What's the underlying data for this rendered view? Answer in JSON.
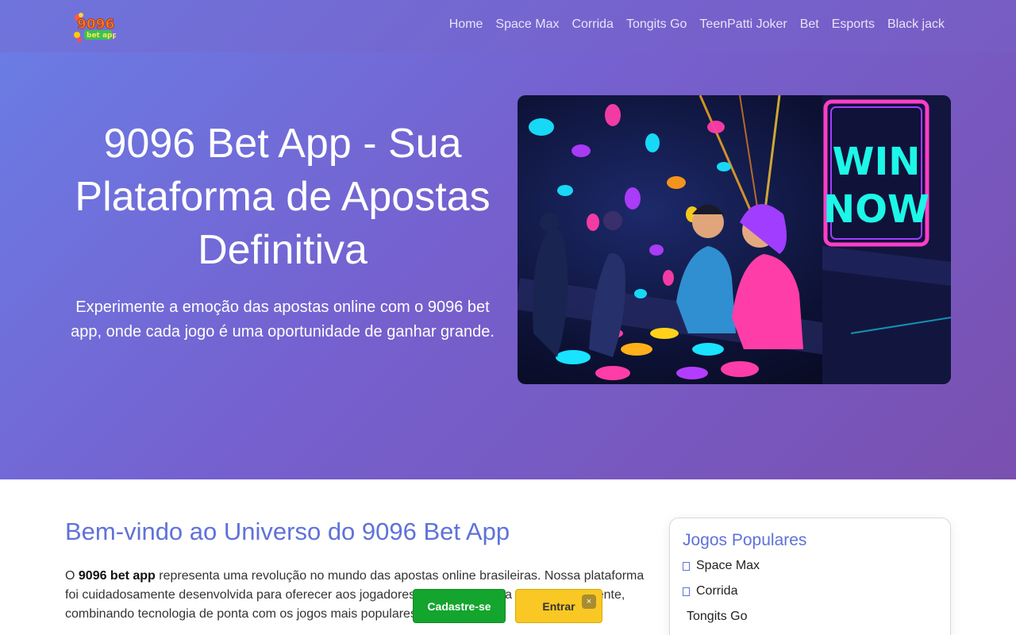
{
  "header": {
    "logo_text": "9096 bet app",
    "nav": [
      "Home",
      "Space Max",
      "Corrida",
      "Tongits Go",
      "TeenPatti Joker",
      "Bet",
      "Esports",
      "Black jack"
    ]
  },
  "hero": {
    "title": "9096 Bet App - Sua Plataforma de Apostas Definitiva",
    "subtitle": "Experimente a emoção das apostas online com o 9096 bet app, onde cada jogo é uma oportunidade de ganhar grande.",
    "image_sign": [
      "WIN",
      "NOW"
    ]
  },
  "main": {
    "heading": "Bem-vindo ao Universo do 9096 Bet App",
    "intro_prefix": "O ",
    "intro_bold": "9096 bet app",
    "intro_rest": " representa uma revolução no mundo das apostas online brasileiras. Nossa plataforma foi cuidadosamente desenvolvida para oferecer aos jogadores uma experiência única e envolvente, combinando tecnologia de ponta com os jogos mais populares do"
  },
  "sidebar": {
    "title": "Jogos Populares",
    "items": [
      {
        "label": "Space Max",
        "icon": "square-icon"
      },
      {
        "label": "Corrida",
        "icon": "square-icon"
      },
      {
        "label": "Tongits Go",
        "icon": ""
      }
    ]
  },
  "cta": {
    "signup": "Cadastre-se",
    "login": "Entrar",
    "close": "×"
  },
  "colors": {
    "accent": "#5f72d9",
    "signup": "#14a52e",
    "login": "#f9c824"
  }
}
